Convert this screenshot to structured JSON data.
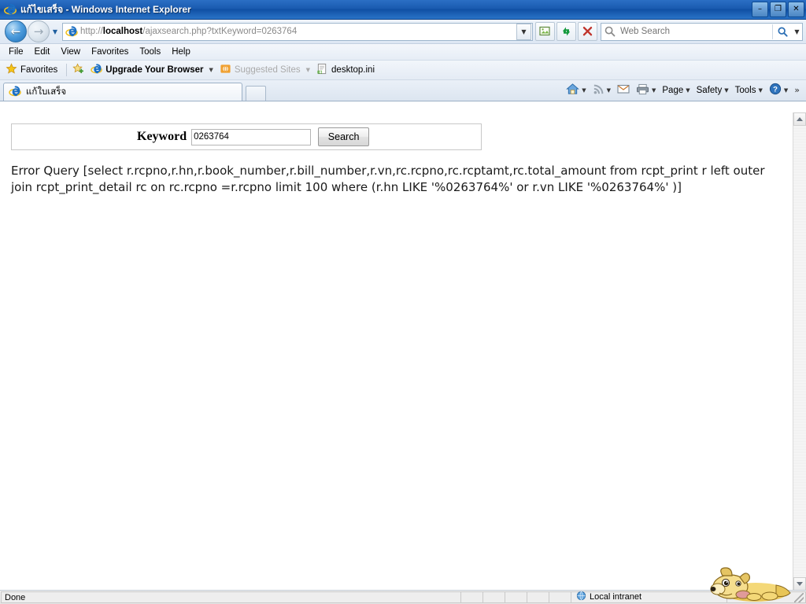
{
  "window": {
    "title_thai": "แก้ไขเสร็จ",
    "title_suffix": " - Windows Internet Explorer",
    "minimize_label": "–",
    "restore_label": "❐",
    "close_label": "✕",
    "icon": "ie-logo-icon"
  },
  "nav": {
    "back_label": "←",
    "forward_label": "→",
    "history_caret": "▼",
    "address": {
      "scheme": "http://",
      "host": "localhost",
      "path": "/ajaxsearch.php?txtKeyword=0263764",
      "full": "http://localhost/ajaxsearch.php?txtKeyword=0263764",
      "dropdown_caret": "▼"
    },
    "buttons": [
      {
        "name": "compatibility-view-icon",
        "glyph": "🖼"
      },
      {
        "name": "refresh-icon",
        "glyph": "↻"
      },
      {
        "name": "stop-icon",
        "glyph": "✕"
      }
    ],
    "search": {
      "placeholder": "Web Search",
      "go_icon": "magnifier-icon",
      "caret": "▼"
    }
  },
  "menubar": {
    "items": [
      {
        "label": "File"
      },
      {
        "label": "Edit"
      },
      {
        "label": "View"
      },
      {
        "label": "Favorites"
      },
      {
        "label": "Tools"
      },
      {
        "label": "Help"
      }
    ]
  },
  "favbar": {
    "favorites_label": "Favorites",
    "items": [
      {
        "label": "Upgrade Your Browser",
        "bold": true,
        "dim": false,
        "caret": "▼"
      },
      {
        "label": "Suggested Sites",
        "bold": false,
        "dim": true,
        "caret": "▼"
      },
      {
        "label": "desktop.ini",
        "bold": false,
        "dim": false,
        "caret": ""
      }
    ]
  },
  "tabs": {
    "active_tab_label": "แก้ใบเสร็จ",
    "new_tab_tooltip": ""
  },
  "commandbar": {
    "items": [
      {
        "label": "",
        "icon": "home-icon",
        "caret": "▼"
      },
      {
        "label": "",
        "icon": "feeds-icon",
        "caret": "▼"
      },
      {
        "label": "",
        "icon": "mail-icon",
        "caret": ""
      },
      {
        "label": "",
        "icon": "print-icon",
        "caret": "▼"
      },
      {
        "label": "Page",
        "icon": "",
        "caret": "▼"
      },
      {
        "label": "Safety",
        "icon": "",
        "caret": "▼"
      },
      {
        "label": "Tools",
        "icon": "",
        "caret": "▼"
      },
      {
        "label": "",
        "icon": "help-icon",
        "caret": "▼"
      }
    ],
    "overflow_label": "»"
  },
  "page": {
    "form": {
      "keyword_label": "Keyword",
      "keyword_value": "0263764",
      "keyword_placeholder": "",
      "search_button_label": "Search"
    },
    "error": {
      "text": "Error Query [select r.rcpno,r.hn,r.book_number,r.bill_number,r.vn,rc.rcpno,rc.rcptamt,rc.total_amount from rcpt_print r left outer join rcpt_print_detail rc on rc.rcpno =r.rcpno limit 100 where (r.hn LIKE '%0263764%' or r.vn LIKE '%0263764%' )]"
    }
  },
  "scrollbar": {
    "up_label": "▲",
    "down_label": "▼"
  },
  "statusbar": {
    "status_text": "Done",
    "zone_label": "Local intranet",
    "zone_icon": "globe-icon"
  },
  "overlay": {
    "mascot": "dog-mascot-icon"
  },
  "colors": {
    "titlebar_blue": "#1a5bb0",
    "accent_blue": "#1e6fb8",
    "page_bg": "#ffffff",
    "chrome_bg": "#e6edf6",
    "text": "#000000"
  }
}
